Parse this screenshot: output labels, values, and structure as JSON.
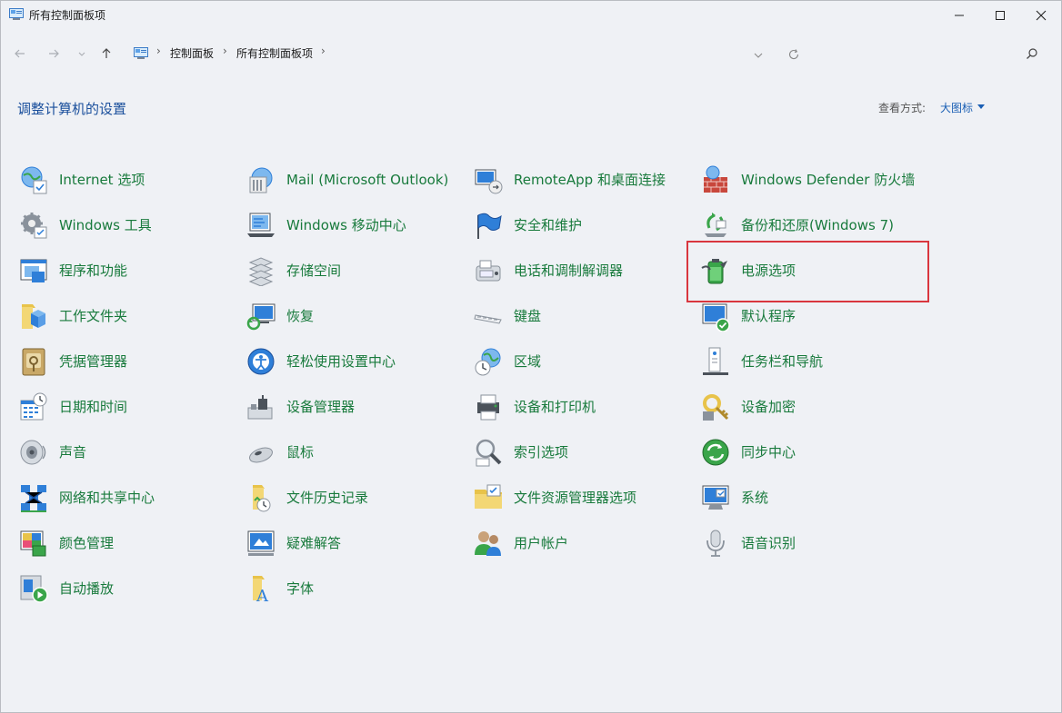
{
  "window": {
    "title": "所有控制面板项"
  },
  "address": {
    "crumbs": [
      "控制面板",
      "所有控制面板项"
    ],
    "separator": "›"
  },
  "header": {
    "title": "调整计算机的设置",
    "view_label": "查看方式:",
    "view_value": "大图标"
  },
  "items": [
    {
      "label": "Internet 选项",
      "icon": "internet-options-icon"
    },
    {
      "label": "Mail (Microsoft Outlook)",
      "icon": "mail-icon"
    },
    {
      "label": "RemoteApp 和桌面连接",
      "icon": "remoteapp-icon"
    },
    {
      "label": "Windows Defender 防火墙",
      "icon": "firewall-icon"
    },
    {
      "label": "Windows 工具",
      "icon": "windows-tools-icon"
    },
    {
      "label": "Windows 移动中心",
      "icon": "mobility-center-icon"
    },
    {
      "label": "安全和维护",
      "icon": "security-flag-icon"
    },
    {
      "label": "备份和还原(Windows 7)",
      "icon": "backup-icon"
    },
    {
      "label": "程序和功能",
      "icon": "programs-icon"
    },
    {
      "label": "存储空间",
      "icon": "storage-spaces-icon"
    },
    {
      "label": "电话和调制解调器",
      "icon": "phone-modem-icon"
    },
    {
      "label": "电源选项",
      "icon": "power-options-icon"
    },
    {
      "label": "工作文件夹",
      "icon": "work-folders-icon"
    },
    {
      "label": "恢复",
      "icon": "recovery-icon"
    },
    {
      "label": "键盘",
      "icon": "keyboard-icon"
    },
    {
      "label": "默认程序",
      "icon": "default-programs-icon"
    },
    {
      "label": "凭据管理器",
      "icon": "credential-manager-icon"
    },
    {
      "label": "轻松使用设置中心",
      "icon": "ease-of-access-icon"
    },
    {
      "label": "区域",
      "icon": "region-icon"
    },
    {
      "label": "任务栏和导航",
      "icon": "taskbar-icon"
    },
    {
      "label": "日期和时间",
      "icon": "date-time-icon"
    },
    {
      "label": "设备管理器",
      "icon": "device-manager-icon"
    },
    {
      "label": "设备和打印机",
      "icon": "devices-printers-icon"
    },
    {
      "label": "设备加密",
      "icon": "device-encryption-icon"
    },
    {
      "label": "声音",
      "icon": "sound-icon"
    },
    {
      "label": "鼠标",
      "icon": "mouse-icon"
    },
    {
      "label": "索引选项",
      "icon": "indexing-icon"
    },
    {
      "label": "同步中心",
      "icon": "sync-center-icon"
    },
    {
      "label": "网络和共享中心",
      "icon": "network-icon"
    },
    {
      "label": "文件历史记录",
      "icon": "file-history-icon"
    },
    {
      "label": "文件资源管理器选项",
      "icon": "explorer-options-icon"
    },
    {
      "label": "系统",
      "icon": "system-icon"
    },
    {
      "label": "颜色管理",
      "icon": "color-management-icon"
    },
    {
      "label": "疑难解答",
      "icon": "troubleshooting-icon"
    },
    {
      "label": "用户帐户",
      "icon": "user-accounts-icon"
    },
    {
      "label": "语音识别",
      "icon": "speech-recognition-icon"
    },
    {
      "label": "自动播放",
      "icon": "autoplay-icon"
    },
    {
      "label": "字体",
      "icon": "fonts-icon"
    }
  ],
  "colors": {
    "link_green": "#187a3c",
    "title_blue": "#1a4f9c",
    "highlight_red": "#d9363e"
  }
}
